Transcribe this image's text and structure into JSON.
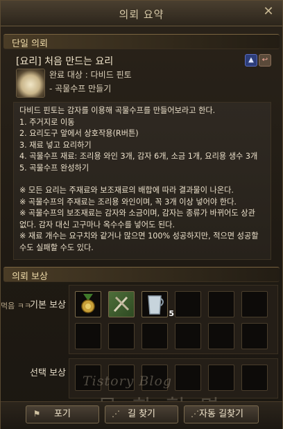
{
  "window": {
    "title": "의뢰 요약",
    "close_icon": "close-icon"
  },
  "section_single": "단일 의뢰",
  "quest": {
    "name": "[요리] 처음 만드는 요리",
    "target": "완료 대상 : 다비드 핀토",
    "objective": "- 곡물수프 만들기",
    "share_icon": "share-icon",
    "abandon_icon": "abandon-icon"
  },
  "description": {
    "lines_a": [
      "다비드 핀토는 감자를 이용해 곡물수프를 만들어보라고 한다.",
      "1. 주거지로 이동",
      "2. 요리도구 앞에서 상호작용(R버튼)",
      "3. 재료 넣고 요리하기",
      "4. 곡물수프 재료: 조리용 와인 3개, 감자 6개, 소금 1개, 요리용 생수 3개",
      "5. 곡물수프 완성하기"
    ],
    "lines_b": [
      "※ 모든 요리는 주재료와 보조재료의 배합에 따라 결과물이 나온다.",
      "※ 곡물수프의 주재료는 조리용 와인이며, 꼭 3개 이상 넣어야 한다.",
      "※ 곡물수프의 보조재료는 감자와 소금이며, 감자는 종류가 바뀌어도 상관",
      "없다. 감자 대신 고구마나 옥수수를 넣어도 된다.",
      "※ 재료 개수는 요구치와 같거나 많으면 100% 성공하지만, 적으면 성공할",
      "수도 실패할 수도 있다."
    ]
  },
  "section_reward": "의뢰 보상",
  "rewards": {
    "basic_label": "기본 보상",
    "choice_label": "선택 보상",
    "basic_items": [
      {
        "icon": "medal-icon",
        "count": ""
      },
      {
        "icon": "cooking-tools-icon",
        "count": ""
      },
      {
        "icon": "measuring-cup-icon",
        "count": "5"
      }
    ]
  },
  "background_chat": "먹음 ㅋㅋ",
  "footer": {
    "abandon_label": "포기",
    "find_label": "길 찾기",
    "auto_find_label": "자동 길찾기"
  },
  "watermark": {
    "line1": "Tistory Blog",
    "line2": "문 희 혁 명"
  }
}
